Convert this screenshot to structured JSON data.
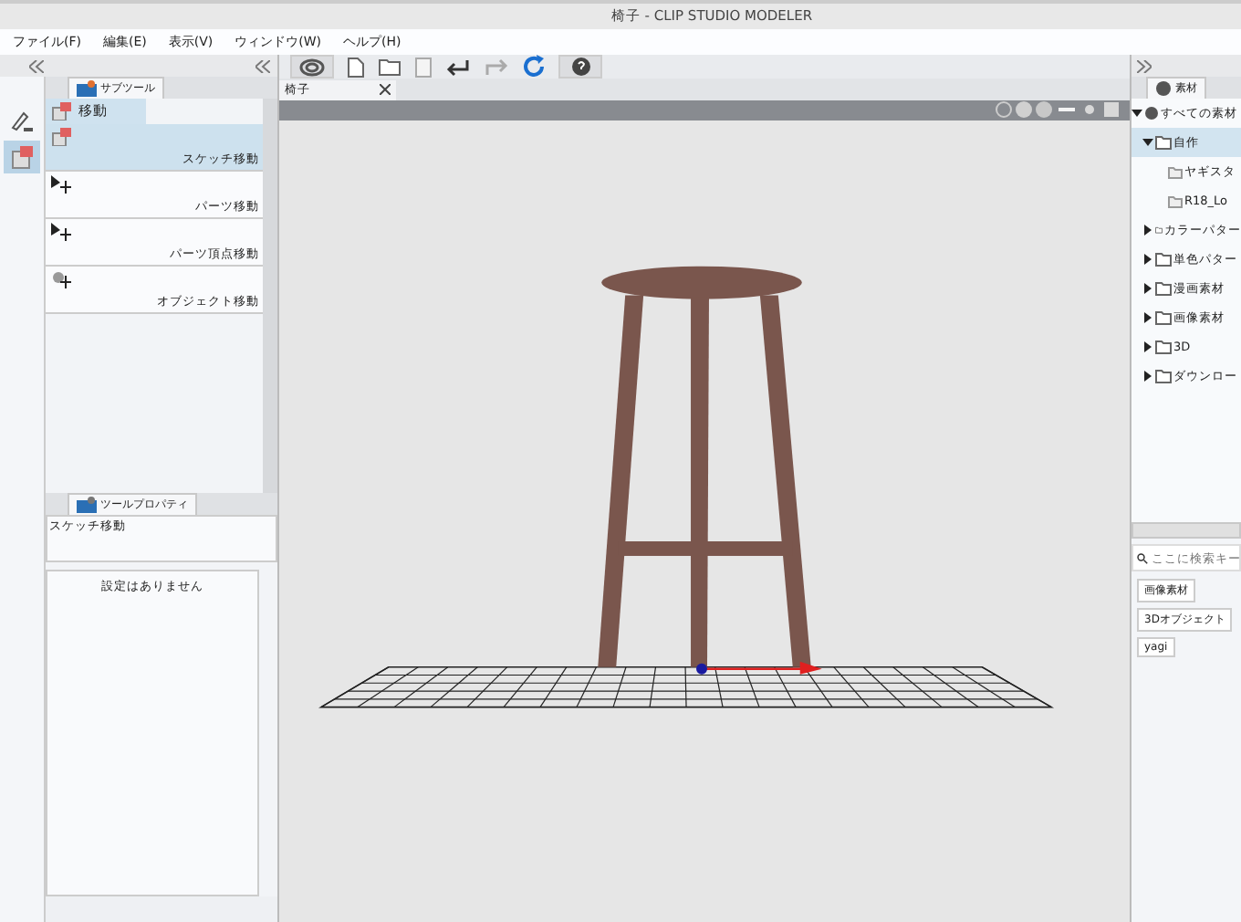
{
  "window": {
    "title": "椅子 - CLIP STUDIO MODELER"
  },
  "menu": [
    "ファイル(F)",
    "編集(E)",
    "表示(V)",
    "ウィンドウ(W)",
    "ヘルプ(H)"
  ],
  "document_tab": {
    "label": "椅子"
  },
  "subtool_panel": {
    "tab_label": "サブツール",
    "group_label": "移動",
    "tools": [
      {
        "label": "スケッチ移動",
        "kind": "sketch",
        "selected": true
      },
      {
        "label": "パーツ移動",
        "kind": "arrow",
        "selected": false
      },
      {
        "label": "パーツ頂点移動",
        "kind": "arrow",
        "selected": false
      },
      {
        "label": "オブジェクト移動",
        "kind": "object",
        "selected": false
      }
    ]
  },
  "tool_property": {
    "tab_label": "ツールプロパティ",
    "tool_name": "スケッチ移動",
    "message": "設定はありません"
  },
  "material_panel": {
    "tab_label": "素材",
    "tree": [
      {
        "label": "すべての素材",
        "expanded": true,
        "selected": false,
        "children": [
          {
            "label": "自作",
            "expanded": true,
            "selected": true,
            "children": [
              {
                "label": "ヤギスタ",
                "selected": false
              },
              {
                "label": "R18_Lo",
                "selected": false
              }
            ]
          },
          {
            "label": "カラーパター",
            "expanded": false,
            "selected": false
          },
          {
            "label": "単色パター",
            "expanded": false,
            "selected": false
          },
          {
            "label": "漫画素材",
            "expanded": false,
            "selected": false
          },
          {
            "label": "画像素材",
            "expanded": false,
            "selected": false
          },
          {
            "label": "3D",
            "expanded": false,
            "selected": false
          },
          {
            "label": "ダウンロー",
            "expanded": false,
            "selected": false
          }
        ]
      }
    ],
    "search": {
      "placeholder": "ここに検索キー"
    },
    "tags": [
      "画像素材",
      "3Dオブジェクト",
      "yagi"
    ]
  }
}
